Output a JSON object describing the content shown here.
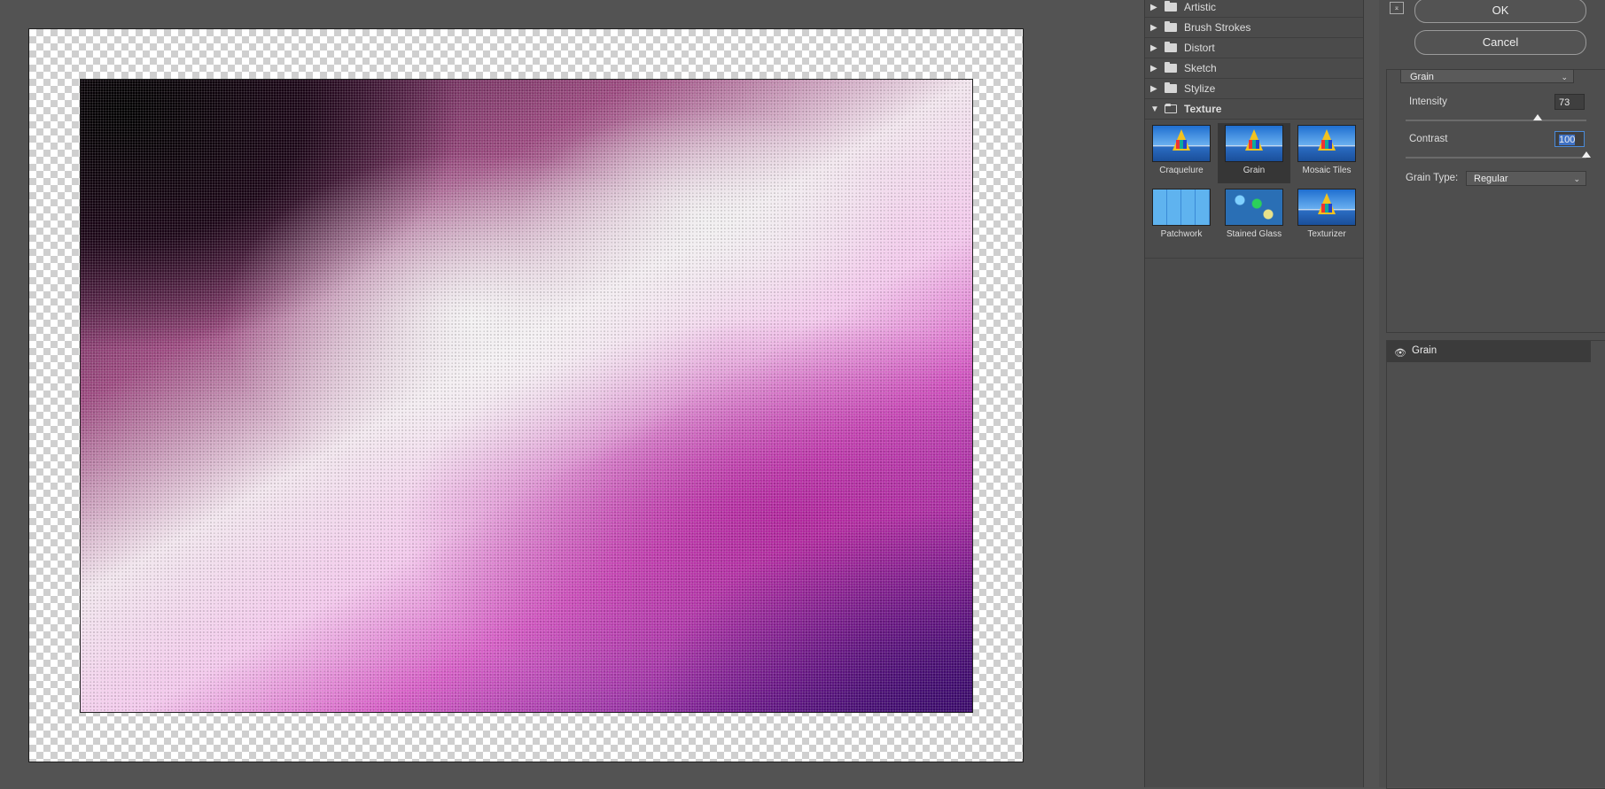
{
  "gallery": {
    "categories": [
      {
        "label": "Artistic",
        "open": false
      },
      {
        "label": "Brush Strokes",
        "open": false
      },
      {
        "label": "Distort",
        "open": false
      },
      {
        "label": "Sketch",
        "open": false
      },
      {
        "label": "Stylize",
        "open": false
      },
      {
        "label": "Texture",
        "open": true
      }
    ],
    "texture_filters": [
      {
        "label": "Craquelure",
        "selected": false
      },
      {
        "label": "Grain",
        "selected": true
      },
      {
        "label": "Mosaic Tiles",
        "selected": false
      },
      {
        "label": "Patchwork",
        "selected": false
      },
      {
        "label": "Stained Glass",
        "selected": false
      },
      {
        "label": "Texturizer",
        "selected": false
      }
    ]
  },
  "buttons": {
    "ok": "OK",
    "cancel": "Cancel"
  },
  "settings": {
    "filter": "Grain",
    "intensity_label": "Intensity",
    "intensity_value": "73",
    "intensity_level": 0.73,
    "contrast_label": "Contrast",
    "contrast_value": "100",
    "contrast_level": 1.0,
    "grain_type_label": "Grain Type:",
    "grain_type_value": "Regular"
  },
  "effect_layers": [
    {
      "name": "Grain",
      "visible": true
    }
  ]
}
